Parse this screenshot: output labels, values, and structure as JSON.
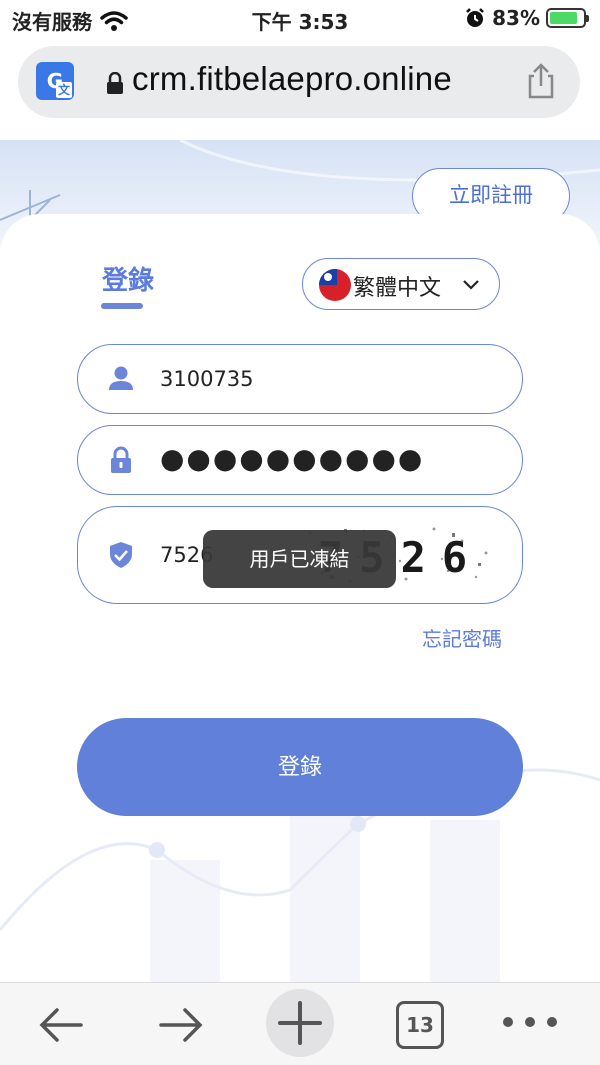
{
  "status_bar": {
    "carrier": "沒有服務",
    "time": "下午 3:53",
    "battery": "83%"
  },
  "browser": {
    "url": "crm.fitbelaepro.online",
    "translate_icon": "G",
    "tab_count": "13"
  },
  "page": {
    "register_button": "立即註冊",
    "login_tab": "登錄",
    "language": "繁體中文",
    "username_value": "3100735",
    "password_mask": "●●●●●●●●●●",
    "captcha_value": "7526",
    "captcha_image_text": "7526",
    "toast_message": "用戶已凍結",
    "forgot_password": "忘記密碼",
    "login_button": "登錄"
  },
  "colors": {
    "accent": "#6080da",
    "accent_text": "#5b7be0"
  },
  "icons": [
    "wifi-icon",
    "alarm-icon",
    "battery-icon",
    "translate-icon",
    "lock-icon",
    "share-icon",
    "flag-icon",
    "chevron-down-icon",
    "user-icon",
    "padlock-icon",
    "shield-icon",
    "back-icon",
    "forward-icon",
    "plus-icon",
    "tabs-icon",
    "more-icon"
  ]
}
